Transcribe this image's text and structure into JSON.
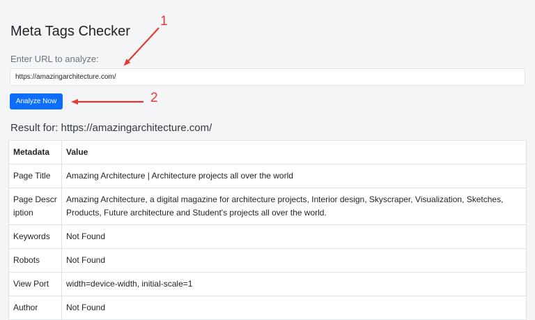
{
  "page": {
    "title": "Meta Tags Checker",
    "url_label": "Enter URL to analyze:",
    "url_value": "https://amazingarchitecture.com/",
    "analyze_label": "Analyze Now",
    "result_heading": "Result for: https://amazingarchitecture.com/"
  },
  "table": {
    "headers": [
      "Metadata",
      "Value"
    ],
    "rows": [
      {
        "key": "Page Title",
        "value": "Amazing Architecture | Architecture projects all over the world"
      },
      {
        "key": "Page Description",
        "value": "Amazing Architecture, a digital magazine for architecture projects, Interior design, Skyscraper, Visualization, Sketches, Products, Future architecture and Student's projects all over the world."
      },
      {
        "key": "Keywords",
        "value": "Not Found"
      },
      {
        "key": "Robots",
        "value": "Not Found"
      },
      {
        "key": "View Port",
        "value": "width=device-width, initial-scale=1"
      },
      {
        "key": "Author",
        "value": "Not Found"
      }
    ]
  },
  "annotations": {
    "label_1": "1",
    "label_2": "2",
    "color": "#e53935"
  },
  "colors": {
    "button": "#0d6efd",
    "background": "#f4f5f6"
  }
}
